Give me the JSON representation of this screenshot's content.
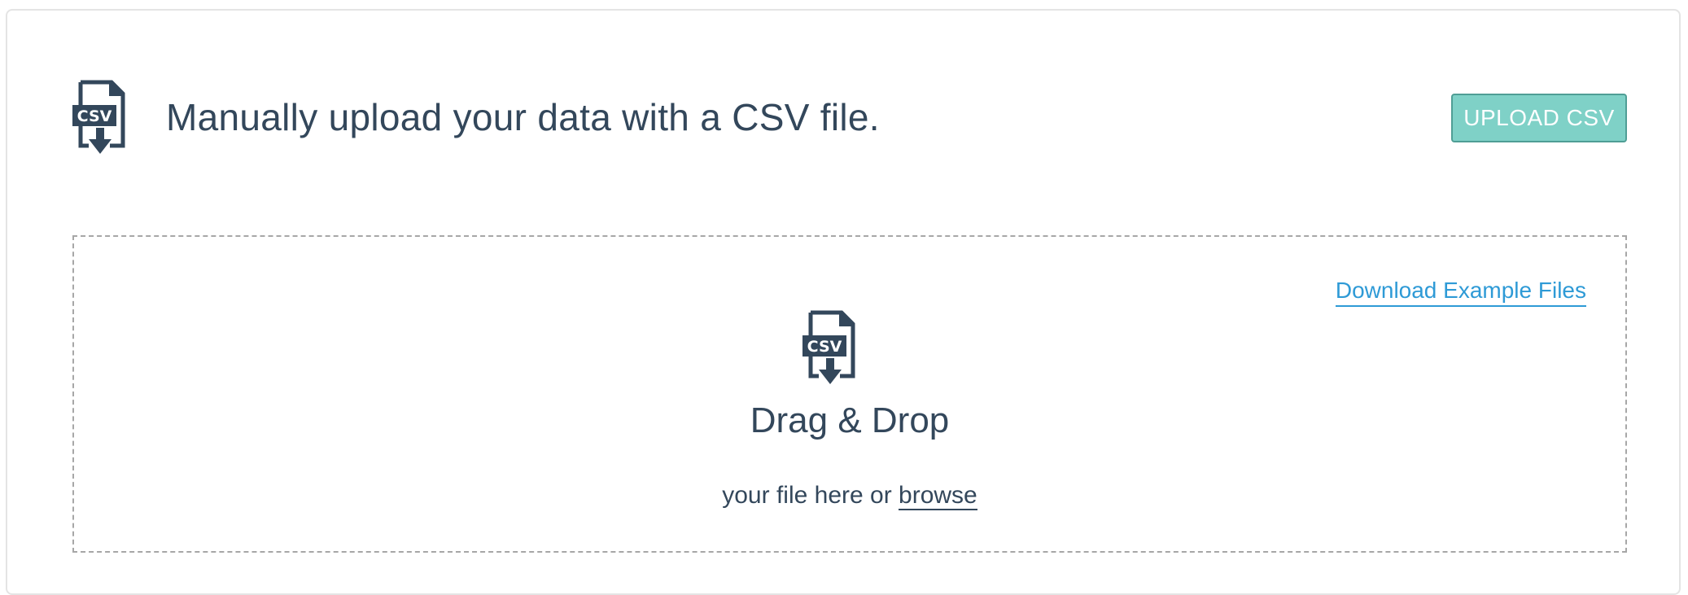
{
  "header": {
    "icon": "csv-file-download-icon",
    "icon_label": "CSV",
    "title": "Manually upload your data with a CSV file.",
    "upload_button_label": "UPLOAD CSV"
  },
  "dropzone": {
    "download_link_label": "Download Example Files",
    "icon": "csv-file-download-icon",
    "icon_label": "CSV",
    "title": "Drag & Drop",
    "subtitle_prefix": "your file here or ",
    "browse_label": "browse"
  },
  "colors": {
    "text": "#33475b",
    "accent": "#7fd1c7",
    "accent_border": "#4f9e95",
    "link": "#2e9ad6",
    "dashed_border": "#a7a7a7"
  }
}
